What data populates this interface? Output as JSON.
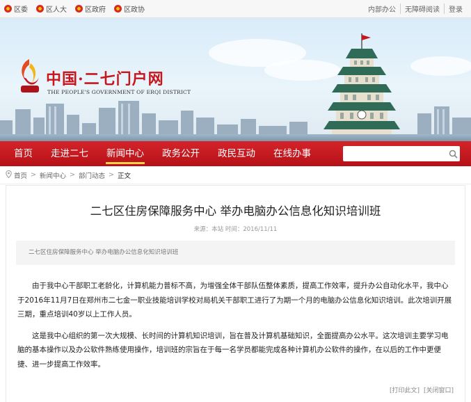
{
  "topbar": {
    "links": [
      "区委",
      "区人大",
      "区政府",
      "区政协"
    ],
    "right": [
      "内部办公",
      "无障碍阅读",
      "登录"
    ]
  },
  "banner": {
    "title": "中国·二七门户网",
    "subtitle": "THE PEOPLE'S GOVERNMENT OF ERQI DISTRICT"
  },
  "nav": {
    "items": [
      "首页",
      "走进二七",
      "新闻中心",
      "政务公开",
      "政民互动",
      "在线办事"
    ],
    "active": "新闻中心"
  },
  "search": {
    "value": ""
  },
  "breadcrumb": [
    "首页",
    "新闻中心",
    "部门动态",
    "正文"
  ],
  "article": {
    "title": "二七区住房保障服务中心 举办电脑办公信息化知识培训班",
    "meta": "来源：本站  时间：2016/11/11",
    "summary": "二七区住房保障服务中心 举办电脑办公信息化知识培训班",
    "paragraphs": [
      "由于我中心干部职工老龄化，计算机能力普标不高，为增强全体干部队伍整体素质，提高工作效率，提升办公自动化水平，我中心于2016年11月7日在郑州市二七金一职业技能培训学校对局机关干部职工进行了为期一个月的电脑办公信息化知识培训。此次培训开展三期，重点培训40岁以上工作人员。",
      "这是我中心组织的第一次大规模、长时间的计算机知识培训，旨在普及计算机基础知识，全面提高办公水平。这次培训主要学习电脑的基本操作以及办公软件熟练使用操作，培训班的宗旨在于每一名学员都能完成各种计算机办公软件的操作，在以后的工作中更便捷、进一步提高工作效率。"
    ],
    "print_label": "[打印此文]",
    "close_label": "[关闭窗口]"
  },
  "colors": {
    "brand_red": "#c8161d",
    "nav_red": "#c41a20",
    "accent": "#f6d34a"
  }
}
